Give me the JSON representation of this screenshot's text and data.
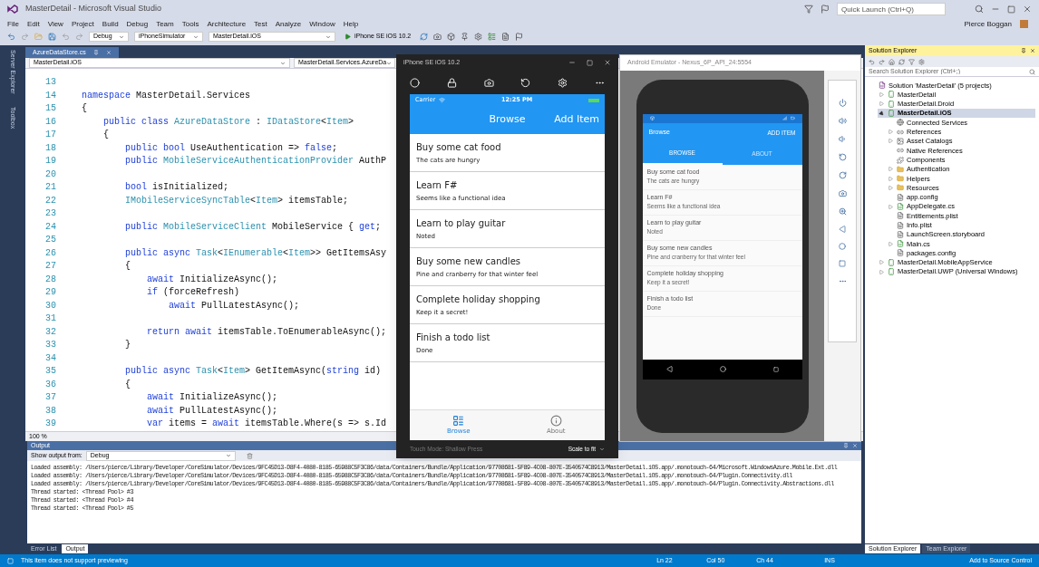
{
  "window": {
    "title": "MasterDetail - Microsoft Visual Studio",
    "quick_launch": {
      "placeholder": "Quick Launch (Ctrl+Q)"
    },
    "user": "Pierce Boggan"
  },
  "menu": [
    "File",
    "Edit",
    "View",
    "Project",
    "Build",
    "Debug",
    "Team",
    "Tools",
    "Architecture",
    "Test",
    "Analyze",
    "Window",
    "Help"
  ],
  "toolbar": {
    "configuration": "Debug",
    "platform": "iPhoneSimulator",
    "project": "MasterDetail.iOS",
    "target": "iPhone SE iOS 10.2"
  },
  "side_tabs": [
    "Server Explorer",
    "Toolbox"
  ],
  "editor": {
    "tab": {
      "label": "AzureDataStore.cs",
      "selected": true
    },
    "project_combo": "MasterDetail.iOS",
    "class_combo": "MasterDetail.Services.AzureDa",
    "zoom": "100 %",
    "lines": [
      {
        "number": "13"
      },
      {
        "number": "14",
        "tokens": [
          {
            "kind": "keyword",
            "text": "namespace"
          },
          {
            "kind": "plain",
            "text": " MasterDetail.Services"
          }
        ]
      },
      {
        "number": "15",
        "tokens": [
          {
            "kind": "plain",
            "text": "{"
          }
        ]
      },
      {
        "number": "16",
        "tokens": [
          {
            "kind": "keyword",
            "text": "    public class "
          },
          {
            "kind": "type",
            "text": "AzureDataStore"
          },
          {
            "kind": "plain",
            "text": " : "
          },
          {
            "kind": "type",
            "text": "IDataStore"
          },
          {
            "kind": "plain",
            "text": "<"
          },
          {
            "kind": "type",
            "text": "Item"
          },
          {
            "kind": "plain",
            "text": ">"
          }
        ]
      },
      {
        "number": "17",
        "tokens": [
          {
            "kind": "plain",
            "text": "    {"
          }
        ]
      },
      {
        "number": "18",
        "tokens": [
          {
            "kind": "keyword",
            "text": "        public bool"
          },
          {
            "kind": "plain",
            "text": " UseAuthentication => "
          },
          {
            "kind": "keyword",
            "text": "false"
          },
          {
            "kind": "plain",
            "text": ";"
          }
        ]
      },
      {
        "number": "19",
        "tokens": [
          {
            "kind": "keyword",
            "text": "        public "
          },
          {
            "kind": "type",
            "text": "MobileServiceAuthenticationProvider"
          },
          {
            "kind": "plain",
            "text": " AuthP"
          }
        ]
      },
      {
        "number": "20"
      },
      {
        "number": "21",
        "tokens": [
          {
            "kind": "keyword",
            "text": "        bool"
          },
          {
            "kind": "plain",
            "text": " isInitialized;"
          }
        ]
      },
      {
        "number": "22",
        "tokens": [
          {
            "kind": "type",
            "text": "        IMobileServiceSyncTable"
          },
          {
            "kind": "plain",
            "text": "<"
          },
          {
            "kind": "type",
            "text": "Item"
          },
          {
            "kind": "plain",
            "text": "> itemsTable;"
          }
        ]
      },
      {
        "number": "23"
      },
      {
        "number": "24",
        "tokens": [
          {
            "kind": "keyword",
            "text": "        public "
          },
          {
            "kind": "type",
            "text": "MobileServiceClient"
          },
          {
            "kind": "plain",
            "text": " MobileService { "
          },
          {
            "kind": "keyword",
            "text": "get"
          },
          {
            "kind": "plain",
            "text": ";"
          }
        ]
      },
      {
        "number": "25"
      },
      {
        "number": "26",
        "tokens": [
          {
            "kind": "keyword",
            "text": "        public async "
          },
          {
            "kind": "type",
            "text": "Task"
          },
          {
            "kind": "plain",
            "text": "<"
          },
          {
            "kind": "type",
            "text": "IEnumerable"
          },
          {
            "kind": "plain",
            "text": "<"
          },
          {
            "kind": "type",
            "text": "Item"
          },
          {
            "kind": "plain",
            "text": ">> GetItemsAsy"
          }
        ]
      },
      {
        "number": "27",
        "tokens": [
          {
            "kind": "plain",
            "text": "        {"
          }
        ]
      },
      {
        "number": "28",
        "tokens": [
          {
            "kind": "keyword",
            "text": "            await"
          },
          {
            "kind": "plain",
            "text": " InitializeAsync();"
          }
        ]
      },
      {
        "number": "29",
        "tokens": [
          {
            "kind": "keyword",
            "text": "            if"
          },
          {
            "kind": "plain",
            "text": " (forceRefresh)"
          }
        ]
      },
      {
        "number": "30",
        "tokens": [
          {
            "kind": "keyword",
            "text": "                await"
          },
          {
            "kind": "plain",
            "text": " PullLatestAsync();"
          }
        ]
      },
      {
        "number": "31"
      },
      {
        "number": "32",
        "tokens": [
          {
            "kind": "keyword",
            "text": "            return await"
          },
          {
            "kind": "plain",
            "text": " itemsTable.ToEnumerableAsync();"
          }
        ]
      },
      {
        "number": "33",
        "tokens": [
          {
            "kind": "plain",
            "text": "        }"
          }
        ]
      },
      {
        "number": "34"
      },
      {
        "number": "35",
        "tokens": [
          {
            "kind": "keyword",
            "text": "        public async "
          },
          {
            "kind": "type",
            "text": "Task"
          },
          {
            "kind": "plain",
            "text": "<"
          },
          {
            "kind": "type",
            "text": "Item"
          },
          {
            "kind": "plain",
            "text": "> GetItemAsync("
          },
          {
            "kind": "keyword",
            "text": "string"
          },
          {
            "kind": "plain",
            "text": " id)"
          }
        ]
      },
      {
        "number": "36",
        "tokens": [
          {
            "kind": "plain",
            "text": "        {"
          }
        ]
      },
      {
        "number": "37",
        "tokens": [
          {
            "kind": "keyword",
            "text": "            await"
          },
          {
            "kind": "plain",
            "text": " InitializeAsync();"
          }
        ]
      },
      {
        "number": "38",
        "tokens": [
          {
            "kind": "keyword",
            "text": "            await"
          },
          {
            "kind": "plain",
            "text": " PullLatestAsync();"
          }
        ]
      },
      {
        "number": "39",
        "tokens": [
          {
            "kind": "keyword",
            "text": "            var"
          },
          {
            "kind": "plain",
            "text": " items = "
          },
          {
            "kind": "keyword",
            "text": "await"
          },
          {
            "kind": "plain",
            "text": " itemsTable.Where(s => s.Id"
          }
        ]
      }
    ]
  },
  "ios_simulator": {
    "title": "iPhone SE iOS 10.2",
    "carrier": "Carrier",
    "time": "12:25 PM",
    "nav_title": "Browse",
    "nav_action": "Add Item",
    "items": [
      {
        "title": "Buy some cat food",
        "description": "The cats are hungry"
      },
      {
        "title": "Learn F#",
        "description": "Seems like a functional idea"
      },
      {
        "title": "Learn to play guitar",
        "description": "Noted"
      },
      {
        "title": "Buy some new candles",
        "description": "Pine and cranberry for that winter feel"
      },
      {
        "title": "Complete holiday shopping",
        "description": "Keep it a secret!"
      },
      {
        "title": "Finish a todo list",
        "description": "Done"
      }
    ],
    "tabs": [
      {
        "label": "Browse",
        "kind": "list",
        "selected": true
      },
      {
        "label": "About",
        "kind": "info",
        "selected": false
      }
    ],
    "touch_mode": "Touch Mode: Shallow Press",
    "scale": "Scale to fit"
  },
  "android_emulator": {
    "title": "Android Emulator - Nexus_6P_API_24:5554",
    "app_title": "Browse",
    "action": "ADD ITEM",
    "tabs": [
      {
        "label": "BROWSE",
        "selected": true
      },
      {
        "label": "ABOUT",
        "selected": false
      }
    ],
    "items": [
      {
        "title": "Buy some cat food",
        "description": "The cats are hungry"
      },
      {
        "title": "Learn F#",
        "description": "Seems like a functional idea"
      },
      {
        "title": "Learn to play guitar",
        "description": "Noted"
      },
      {
        "title": "Buy some new candles",
        "description": "Pine and cranberry for that winter feel"
      },
      {
        "title": "Complete holiday shopping",
        "description": "Keep it a secret!"
      },
      {
        "title": "Finish a todo list",
        "description": "Done"
      }
    ]
  },
  "solution_explorer": {
    "title": "Solution Explorer",
    "search": {
      "placeholder": "Search Solution Explorer (Ctrl+;)"
    },
    "tree": [
      {
        "label": "Solution 'MasterDetail' (5 projects)",
        "kind": "solution",
        "selected": false,
        "children": [
          {
            "label": "MasterDetail",
            "kind": "project",
            "expanded": false,
            "selected": false
          },
          {
            "label": "MasterDetail.Droid",
            "kind": "project",
            "expanded": false,
            "selected": false
          },
          {
            "label": "MasterDetail.iOS",
            "kind": "project",
            "expanded": true,
            "selected": true,
            "children": [
              {
                "label": "Connected Services",
                "kind": "service",
                "selected": false
              },
              {
                "label": "References",
                "kind": "reference",
                "expanded": false,
                "selected": false
              },
              {
                "label": "Asset Catalogs",
                "kind": "catalog",
                "expanded": false,
                "selected": false
              },
              {
                "label": "Native References",
                "kind": "reference",
                "selected": false
              },
              {
                "label": "Components",
                "kind": "component",
                "selected": false
              },
              {
                "label": "Authentication",
                "kind": "folder",
                "expanded": false,
                "selected": false
              },
              {
                "label": "Helpers",
                "kind": "folder",
                "expanded": false,
                "selected": false
              },
              {
                "label": "Resources",
                "kind": "folder",
                "expanded": false,
                "selected": false
              },
              {
                "label": "app.config",
                "kind": "file",
                "selected": false
              },
              {
                "label": "AppDelegate.cs",
                "kind": "code",
                "expanded": false,
                "selected": false
              },
              {
                "label": "Entitlements.plist",
                "kind": "file",
                "selected": false
              },
              {
                "label": "Info.plist",
                "kind": "file",
                "selected": false
              },
              {
                "label": "LaunchScreen.storyboard",
                "kind": "file",
                "selected": false
              },
              {
                "label": "Main.cs",
                "kind": "code",
                "expanded": false,
                "selected": false
              },
              {
                "label": "packages.config",
                "kind": "file",
                "selected": false
              }
            ]
          },
          {
            "label": "MasterDetail.MobileAppService",
            "kind": "project",
            "expanded": false,
            "selected": false
          },
          {
            "label": "MasterDetail.UWP (Universal Windows)",
            "kind": "project",
            "expanded": false,
            "selected": false
          }
        ]
      }
    ],
    "tabs": [
      {
        "label": "Solution Explorer",
        "selected": true
      },
      {
        "label": "Team Explorer",
        "selected": false
      }
    ]
  },
  "output": {
    "title": "Output",
    "source_label": "Show output from:",
    "source": "Debug",
    "lines": [
      "Loaded assembly: /Users/pierce/Library/Developer/CoreSimulator/Devices/9FC45D13-D8F4-4080-8185-65988C5F3C86/data/Containers/Bundle/Application/97708681-5F89-4C08-807E-3540574C8913/MasterDetail.iOS.app/.monotouch-64/Microsoft.WindowsAzure.Mobile.Ext.dll",
      "Loaded assembly: /Users/pierce/Library/Developer/CoreSimulator/Devices/9FC45D13-D8F4-4080-8185-65988C5F3C86/data/Containers/Bundle/Application/97708681-5F89-4C08-807E-3540574C8913/MasterDetail.iOS.app/.monotouch-64/Plugin.Connectivity.dll",
      "Loaded assembly: /Users/pierce/Library/Developer/CoreSimulator/Devices/9FC45D13-D8F4-4080-8185-65988C5F3C86/data/Containers/Bundle/Application/97708681-5F89-4C08-807E-3540574C8913/MasterDetail.iOS.app/.monotouch-64/Plugin.Connectivity.Abstractions.dll",
      "Thread started: <Thread Pool> #3",
      "Thread started: <Thread Pool> #4",
      "Thread started: <Thread Pool> #5"
    ],
    "tabs": [
      {
        "label": "Error List",
        "selected": false
      },
      {
        "label": "Output",
        "selected": true
      }
    ]
  },
  "status_bar": {
    "message": "This item does not support previewing",
    "line": "Ln 22",
    "column": "Col 50",
    "char": "Ch 44",
    "mode": "INS",
    "source_control": "Add to Source Control"
  }
}
